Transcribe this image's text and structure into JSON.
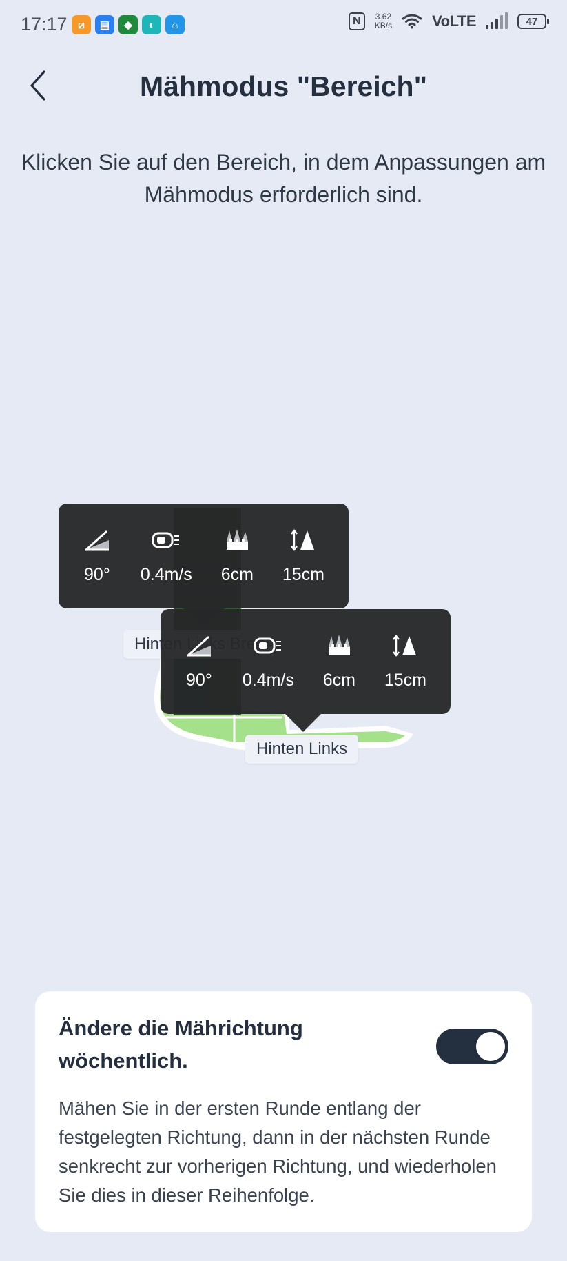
{
  "status_bar": {
    "time": "17:17",
    "net_speed_value": "3.62",
    "net_speed_unit": "KB/s",
    "network_type": "VoLTE",
    "battery_level": "47",
    "app_icons": [
      {
        "name": "orange-app-icon",
        "color": "#f59a2a",
        "glyph": "⧄"
      },
      {
        "name": "blue-app-icon",
        "color": "#2b7ff0",
        "glyph": "▤"
      },
      {
        "name": "green-shield-app-icon",
        "color": "#1f8a3c",
        "glyph": "◆"
      },
      {
        "name": "teal-app-icon",
        "color": "#20b5b8",
        "glyph": "◐"
      },
      {
        "name": "blue-home-app-icon",
        "color": "#2196e8",
        "glyph": "⌂"
      }
    ]
  },
  "header": {
    "title": "Mähmodus \"Bereich\"",
    "back_icon": "chevron-left-icon"
  },
  "instruction": "Klicken Sie auf den Bereich, in dem Anpassungen am Mähmodus erforderlich sind.",
  "map": {
    "zones": [
      {
        "label": "Hinten Links Breit",
        "settings": {
          "angle": "90°",
          "speed": "0.4m/s",
          "cut_height": "6cm",
          "obstacle_height": "15cm"
        }
      },
      {
        "label": "Hinten Links",
        "settings": {
          "angle": "90°",
          "speed": "0.4m/s",
          "cut_height": "6cm",
          "obstacle_height": "15cm"
        }
      }
    ],
    "colors": {
      "lawn_light": "#a5e08a",
      "lawn_dark": "#1f4a15",
      "border": "#ffffff"
    }
  },
  "card": {
    "title": "Ändere die Mährichtung wöchentlich.",
    "toggle_state": "on",
    "description": "Mähen Sie in der ersten Runde entlang der festgelegten Richtung, dann in der nächsten Runde senkrecht zur vorherigen Richtung, und wiederholen Sie dies in dieser Reihenfolge."
  },
  "colors": {
    "background": "#e6eaf4",
    "text_primary": "#24303f",
    "tooltip_bg": "#26282a",
    "toggle_on": "#24303f"
  }
}
